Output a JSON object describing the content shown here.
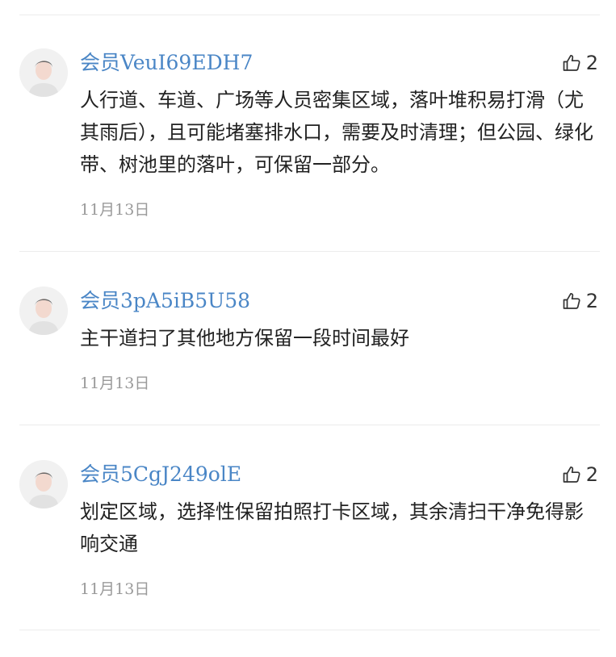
{
  "comments": [
    {
      "username": "会员VeuI69EDH7",
      "likes": "2",
      "content": "人行道、车道、广场等人员密集区域，落叶堆积易打滑（尤其雨后），且可能堵塞排水口，需要及时清理；但公园、绿化带、树池里的落叶，可保留一部分。",
      "date": "11月13日"
    },
    {
      "username": "会员3pA5iB5U58",
      "likes": "2",
      "content": "主干道扫了其他地方保留一段时间最好",
      "date": "11月13日"
    },
    {
      "username": "会员5CgJ249olE",
      "likes": "2",
      "content": "划定区域，选择性保留拍照打卡区域，其余清扫干净免得影响交通",
      "date": "11月13日"
    }
  ],
  "icons": {
    "avatar": "default-avatar-icon",
    "like": "thumbs-up-icon"
  },
  "colors": {
    "username": "#4a86c6",
    "content": "#222222",
    "date": "#9a9a9a",
    "divider": "#ececec"
  }
}
